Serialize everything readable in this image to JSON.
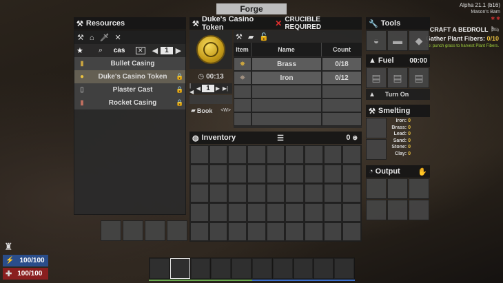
{
  "window_title": "Forge",
  "version": "Alpha 21.1 (b16)",
  "location": "Mason's Barn",
  "quest": {
    "title": "CRAFT A BEDROLL",
    "objective_label": "Gather Plant Fibers:",
    "objective_progress": "0/10",
    "tip_prefix": "Tip:",
    "tip_text": "punch grass to harvest Plant Fibers."
  },
  "resources": {
    "header": "Resources",
    "search_value": "cas",
    "page": "1",
    "items": [
      {
        "label": "Bullet Casing",
        "locked": false
      },
      {
        "label": "Duke's Casino Token",
        "locked": true,
        "selected": true
      },
      {
        "label": "Plaster Cast",
        "locked": true
      },
      {
        "label": "Rocket Casing",
        "locked": true
      }
    ]
  },
  "recipe": {
    "name": "Duke's Casino Token",
    "warning": "CRUCIBLE REQUIRED",
    "craft_time": "00:13",
    "quantity": "1",
    "book_label": "Book",
    "book_key": "<W>",
    "columns": {
      "item": "Item",
      "name": "Name",
      "count": "Count"
    },
    "ingredients": [
      {
        "name": "Brass",
        "count": "0/18"
      },
      {
        "name": "Iron",
        "count": "0/12"
      }
    ]
  },
  "inventory": {
    "header": "Inventory",
    "coins": "0"
  },
  "tools": {
    "header": "Tools"
  },
  "fuel": {
    "header": "Fuel",
    "time": "00:00",
    "button": "Turn On"
  },
  "smelting": {
    "header": "Smelting",
    "materials": [
      {
        "label": "Iron:",
        "value": "0"
      },
      {
        "label": "Brass:",
        "value": "0"
      },
      {
        "label": "Lead:",
        "value": "0"
      },
      {
        "label": "Sand:",
        "value": "0"
      },
      {
        "label": "Stone:",
        "value": "0"
      },
      {
        "label": "Clay:",
        "value": "0"
      }
    ]
  },
  "output": {
    "header": "Output"
  },
  "stats": {
    "stamina": "100/100",
    "health": "100/100"
  },
  "colors": {
    "accent_gold": "#e8c040",
    "quest_green": "#9fd23c",
    "stamina_blue": "#2a4d8a",
    "health_red": "#8a1f1f",
    "warning_red": "#e0302e"
  }
}
